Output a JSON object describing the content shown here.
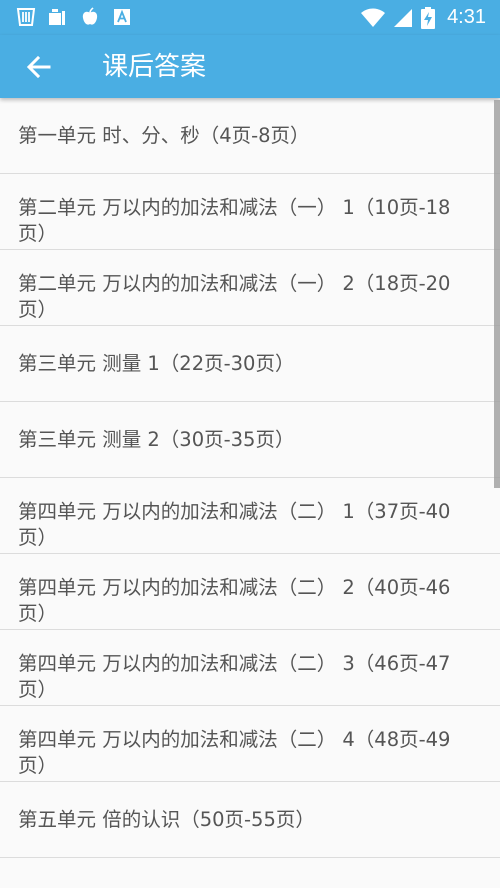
{
  "status_bar": {
    "time": "4:31",
    "icons": [
      "app-w-icon",
      "charging-dock-icon",
      "apple-icon",
      "dictionary-a-icon",
      "wifi-icon",
      "cell-signal-icon",
      "battery-charging-icon"
    ]
  },
  "app_bar": {
    "title": "课后答案",
    "back_icon": "arrow-left-icon"
  },
  "list": {
    "items": [
      {
        "label": "第一单元 时、分、秒（4页-8页）"
      },
      {
        "label": "第二单元 万以内的加法和减法（一） 1（10页-18页）"
      },
      {
        "label": "第二单元 万以内的加法和减法（一） 2（18页-20页）"
      },
      {
        "label": "第三单元 测量 1（22页-30页）"
      },
      {
        "label": "第三单元 测量 2（30页-35页）"
      },
      {
        "label": "第四单元 万以内的加法和减法（二） 1（37页-40页）"
      },
      {
        "label": "第四单元 万以内的加法和减法（二） 2（40页-46页）"
      },
      {
        "label": "第四单元 万以内的加法和减法（二） 3（46页-47页）"
      },
      {
        "label": "第四单元 万以内的加法和减法（二） 4（48页-49页）"
      },
      {
        "label": "第五单元 倍的认识（50页-55页）"
      }
    ]
  },
  "colors": {
    "primary": "#4aaee3",
    "list_background": "#fafafa",
    "text": "#555555",
    "divider": "#dcdcdc"
  }
}
